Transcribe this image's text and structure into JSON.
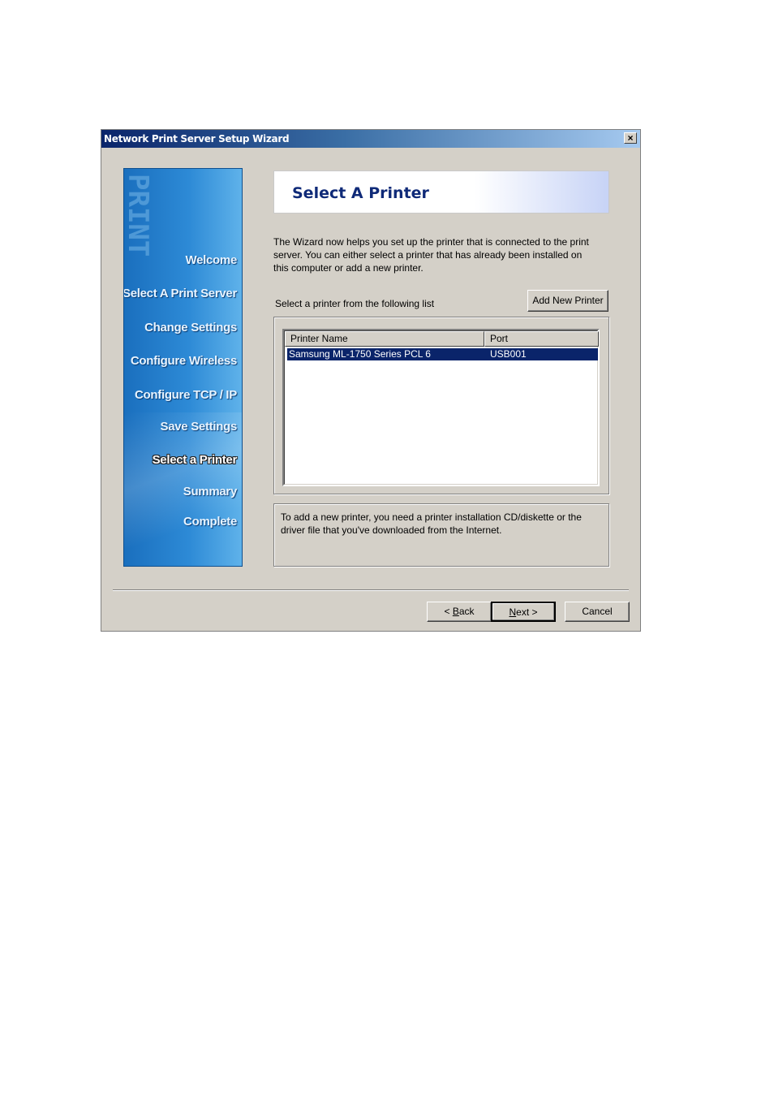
{
  "window": {
    "title": "Network Print Server Setup Wizard",
    "close_label": "×"
  },
  "sidebar": {
    "decor_text": "PRINT",
    "steps": [
      {
        "label": "Welcome"
      },
      {
        "label": "Select A Print Server"
      },
      {
        "label": "Change Settings"
      },
      {
        "label": "Configure Wireless"
      },
      {
        "label": "Configure TCP / IP"
      },
      {
        "label": "Save Settings"
      },
      {
        "label": "Select a Printer",
        "active": true
      },
      {
        "label": "Summary"
      },
      {
        "label": "Complete"
      }
    ]
  },
  "header": {
    "title": "Select A Printer"
  },
  "main": {
    "description": "The Wizard now helps you set up the printer that is connected to the print server. You can either select a printer that has already been installed on this computer or add a new printer.",
    "select_label": "Select a printer from the following list",
    "add_printer_button": "Add New Printer",
    "list": {
      "columns": [
        "Printer Name",
        "Port"
      ],
      "rows": [
        {
          "name": "Samsung ML-1750 Series PCL 6",
          "port": "USB001",
          "selected": true
        }
      ]
    },
    "note": "To add a new printer, you need a printer installation CD/diskette or the driver file that you've downloaded from the Internet."
  },
  "footer": {
    "back_prefix": "< ",
    "back_key": "B",
    "back_rest": "ack",
    "next_key": "N",
    "next_rest": "ext >",
    "cancel_label": "Cancel"
  },
  "colors": {
    "title_bar_start": "#0a246a",
    "sidebar_blue": "#2d8ad6",
    "selection": "#0a246a",
    "header_title": "#0f2a78"
  }
}
